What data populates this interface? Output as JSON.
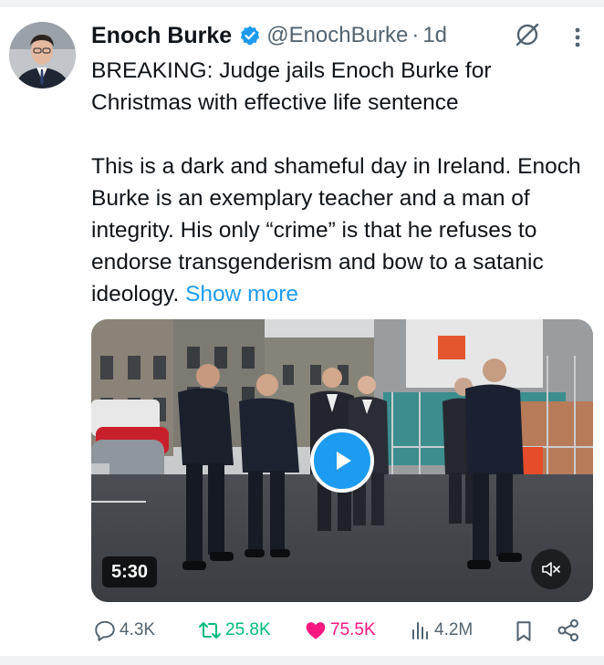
{
  "author": {
    "name": "Enoch Burke",
    "verified_icon": "verified-badge-icon",
    "handle": "@EnochBurke",
    "separator": "·",
    "time": "1d"
  },
  "tweet": {
    "line1": "BREAKING: Judge jails Enoch Burke for Christmas with effective life sentence",
    "line2": "This is a dark and shameful day in Ireland. Enoch Burke is an exemplary teacher and a man of integrity. His only “crime” is that he refuses to endorse transgenderism and bow to a satanic ideology.",
    "show_more": "Show more"
  },
  "media": {
    "duration": "5:30",
    "play_icon": "play-icon",
    "mute_icon": "speaker-muted-icon"
  },
  "actions": {
    "replies": "4.3K",
    "reposts": "25.8K",
    "likes": "75.5K",
    "views": "4.2M"
  },
  "colors": {
    "accent": "#1d9bf0",
    "repost": "#00ba7c",
    "like": "#f91880",
    "secondary_text": "#536471",
    "primary_text": "#0f1419"
  }
}
